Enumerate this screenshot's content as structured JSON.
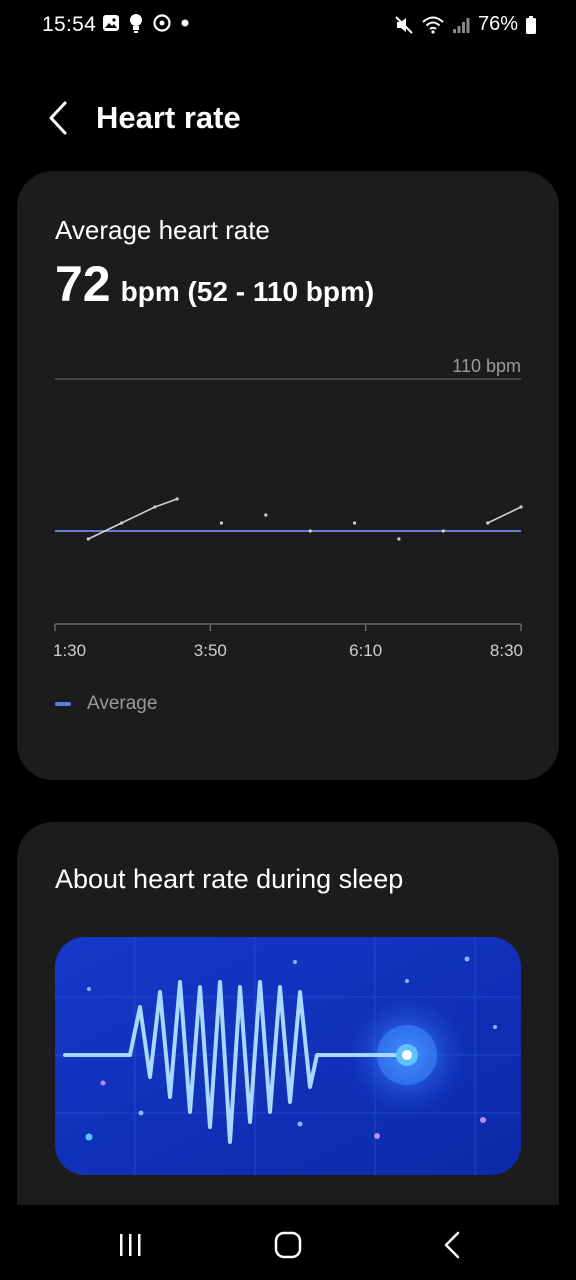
{
  "status_bar": {
    "time": "15:54",
    "battery": "76%"
  },
  "header": {
    "title": "Heart rate"
  },
  "heart_rate_card": {
    "label": "Average heart rate",
    "value": "72",
    "unit_range": "bpm (52 - 110 bpm)",
    "max_label": "110 bpm",
    "legend_label": "Average"
  },
  "chart_data": {
    "type": "line",
    "title": "",
    "xlabel": "",
    "ylabel": "",
    "x_ticks": [
      "1:30",
      "3:50",
      "6:10",
      "8:30"
    ],
    "ylim": [
      0,
      110
    ],
    "average": 72,
    "series": [
      {
        "values": [
          {
            "x": "2:00",
            "y": 70
          },
          {
            "x": "2:30",
            "y": 74
          },
          {
            "x": "3:00",
            "y": 78
          },
          {
            "x": "3:20",
            "y": 80
          },
          {
            "x": "4:00",
            "y": 74
          },
          {
            "x": "4:40",
            "y": 76
          },
          {
            "x": "5:20",
            "y": 72
          },
          {
            "x": "6:00",
            "y": 74
          },
          {
            "x": "6:40",
            "y": 70
          },
          {
            "x": "7:20",
            "y": 72
          },
          {
            "x": "8:00",
            "y": 74
          },
          {
            "x": "8:30",
            "y": 78
          }
        ]
      }
    ]
  },
  "about_card": {
    "title": "About heart rate during sleep"
  },
  "colors": {
    "average_line": "#6b77d6",
    "card_bg": "#1c1c1e",
    "banner_blue": "#1a3fd6"
  }
}
